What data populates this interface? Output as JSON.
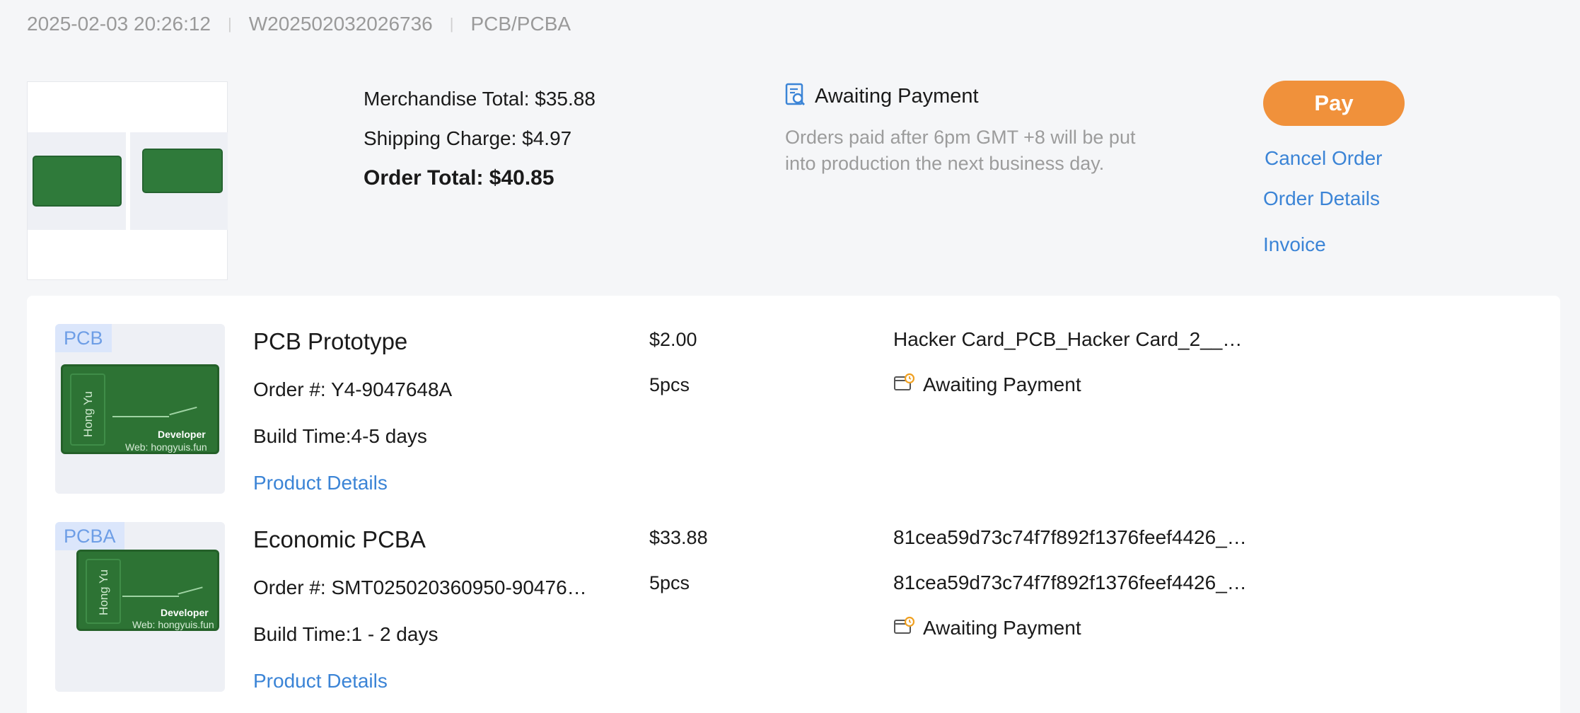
{
  "header": {
    "datetime": "2025-02-03 20:26:12",
    "order_id": "W202502032026736",
    "category": "PCB/PCBA"
  },
  "summary": {
    "merchandise_total": "Merchandise Total: $35.88",
    "shipping_charge": "Shipping Charge: $4.97",
    "order_total": "Order Total: $40.85",
    "status_icon": "search-document-icon",
    "status": "Awaiting Payment",
    "note": "Orders paid after 6pm GMT +8 will be put into production the next business day."
  },
  "actions": {
    "pay": "Pay",
    "cancel": "Cancel Order",
    "details": "Order Details",
    "invoice": "Invoice"
  },
  "board_art": {
    "vertical_text": "Hong Yu",
    "brand": "Developer",
    "web": "Web: hongyuis.fun"
  },
  "items": [
    {
      "tag": "PCB",
      "title": "PCB Prototype",
      "order_no": "Order #: Y4-9047648A",
      "build_time": "Build Time:4-5 days",
      "details_link": "Product Details",
      "price": "$2.00",
      "qty": "5pcs",
      "file1": "Hacker Card_PCB_Hacker Card_2__…",
      "status_icon": "wallet-clock-icon",
      "status": "Awaiting Payment"
    },
    {
      "tag": "PCBA",
      "title": "Economic PCBA",
      "order_no": "Order #: SMT025020360950-90476…",
      "build_time": "Build Time:1 - 2 days",
      "details_link": "Product Details",
      "price": "$33.88",
      "qty": "5pcs",
      "file1": "81cea59d73c74f7f892f1376feef4426_…",
      "file2": "81cea59d73c74f7f892f1376feef4426_…",
      "status_icon": "wallet-clock-icon",
      "status": "Awaiting Payment"
    }
  ],
  "colors": {
    "accent": "#3b84d6",
    "pay": "#f0913b",
    "muted": "#9a9a9a",
    "status_icon": "#f0a020"
  }
}
